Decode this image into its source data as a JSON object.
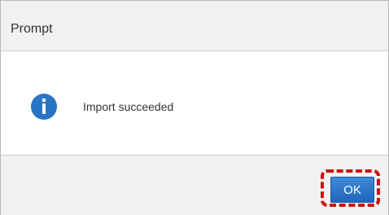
{
  "dialog": {
    "title": "Prompt",
    "message": "Import succeeded",
    "icon": "info-icon",
    "ok_label": "OK"
  },
  "colors": {
    "accent": "#2a74c4",
    "highlight": "#cc1111"
  }
}
